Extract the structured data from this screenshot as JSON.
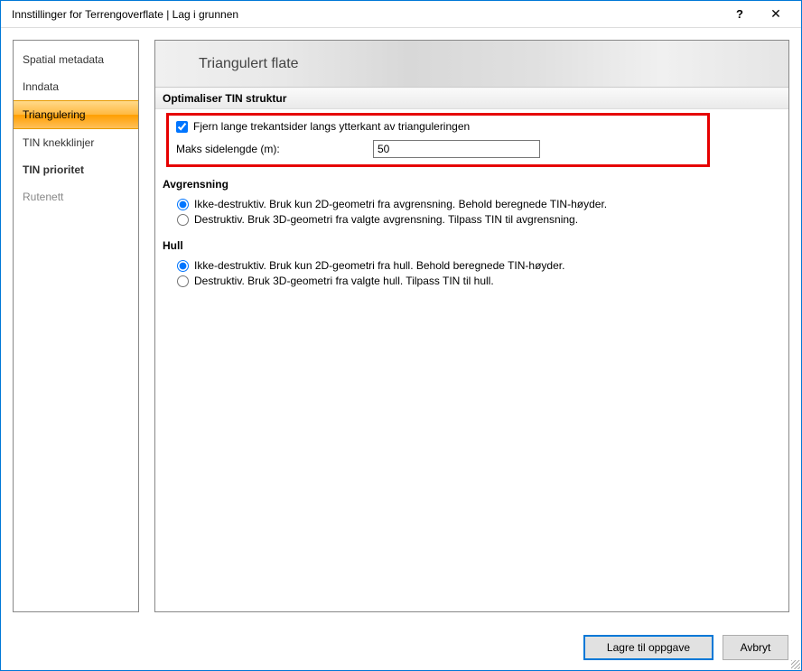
{
  "titlebar": {
    "title": "Innstillinger for Terrengoverflate |  Lag i grunnen",
    "help": "?",
    "close": "✕"
  },
  "sidebar": {
    "items": [
      {
        "label": "Spatial metadata",
        "selected": false
      },
      {
        "label": "Inndata",
        "selected": false
      },
      {
        "label": "Triangulering",
        "selected": true
      },
      {
        "label": "TIN knekklinjer",
        "selected": false
      },
      {
        "label": "TIN prioritet",
        "selected": false,
        "bold": true
      },
      {
        "label": "Rutenett",
        "selected": false,
        "grey": true
      }
    ]
  },
  "panel": {
    "heading": "Triangulert flate",
    "section1": {
      "title": "Optimaliser TIN struktur",
      "checkbox_label": "Fjern lange trekantsider langs ytterkant av trianguleringen",
      "checkbox_checked": true,
      "field_label": "Maks sidelengde (m):",
      "field_value": "50"
    },
    "section2": {
      "title": "Avgrensning",
      "option1": "Ikke-destruktiv. Bruk kun 2D-geometri fra avgrensning. Behold beregnede TIN-høyder.",
      "option2": "Destruktiv. Bruk 3D-geometri fra valgte avgrensning. Tilpass TIN til avgrensning."
    },
    "section3": {
      "title": "Hull",
      "option1": "Ikke-destruktiv. Bruk kun 2D-geometri fra hull. Behold beregnede TIN-høyder.",
      "option2": "Destruktiv. Bruk 3D-geometri fra valgte hull. Tilpass TIN til hull."
    }
  },
  "footer": {
    "save": "Lagre til oppgave",
    "cancel": "Avbryt"
  }
}
